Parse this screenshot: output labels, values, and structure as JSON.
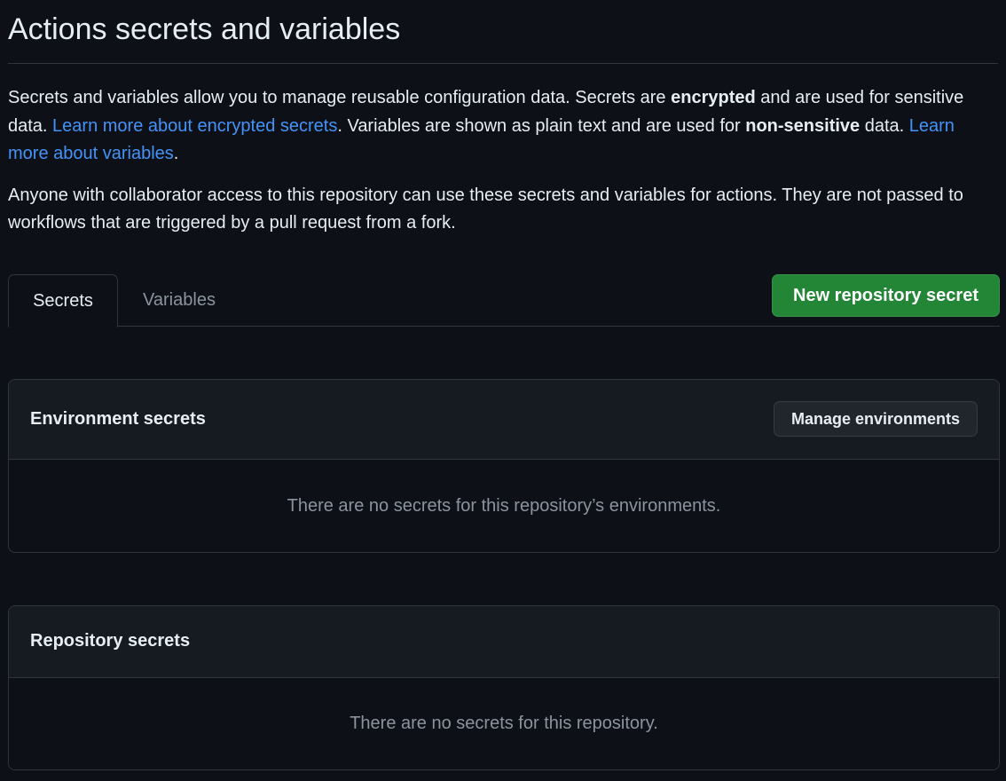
{
  "page": {
    "title": "Actions secrets and variables"
  },
  "intro": {
    "p1_part1": "Secrets and variables allow you to manage reusable configuration data. Secrets are ",
    "p1_bold1": "encrypted",
    "p1_part2": " and are used for sensitive data. ",
    "p1_link1": "Learn more about encrypted secrets",
    "p1_part3": ". Variables are shown as plain text and are used for ",
    "p1_bold2": "non-sensitive",
    "p1_part4": " data. ",
    "p1_link2": "Learn more about variables",
    "p1_part5": ".",
    "p2": "Anyone with collaborator access to this repository can use these secrets and variables for actions. They are not passed to workflows that are triggered by a pull request from a fork."
  },
  "tabs": [
    {
      "label": "Secrets",
      "selected": true
    },
    {
      "label": "Variables",
      "selected": false
    }
  ],
  "actions": {
    "new_secret_label": "New repository secret"
  },
  "environment_secrets": {
    "title": "Environment secrets",
    "manage_label": "Manage environments",
    "empty_text": "There are no secrets for this repository’s environments."
  },
  "repository_secrets": {
    "title": "Repository secrets",
    "empty_text": "There are no secrets for this repository."
  },
  "colors": {
    "background": "#0d1117",
    "panel_header": "#161b22",
    "border": "#30363d",
    "link": "#4493f8",
    "primary_button": "#238636",
    "muted_text": "#8b949e"
  }
}
